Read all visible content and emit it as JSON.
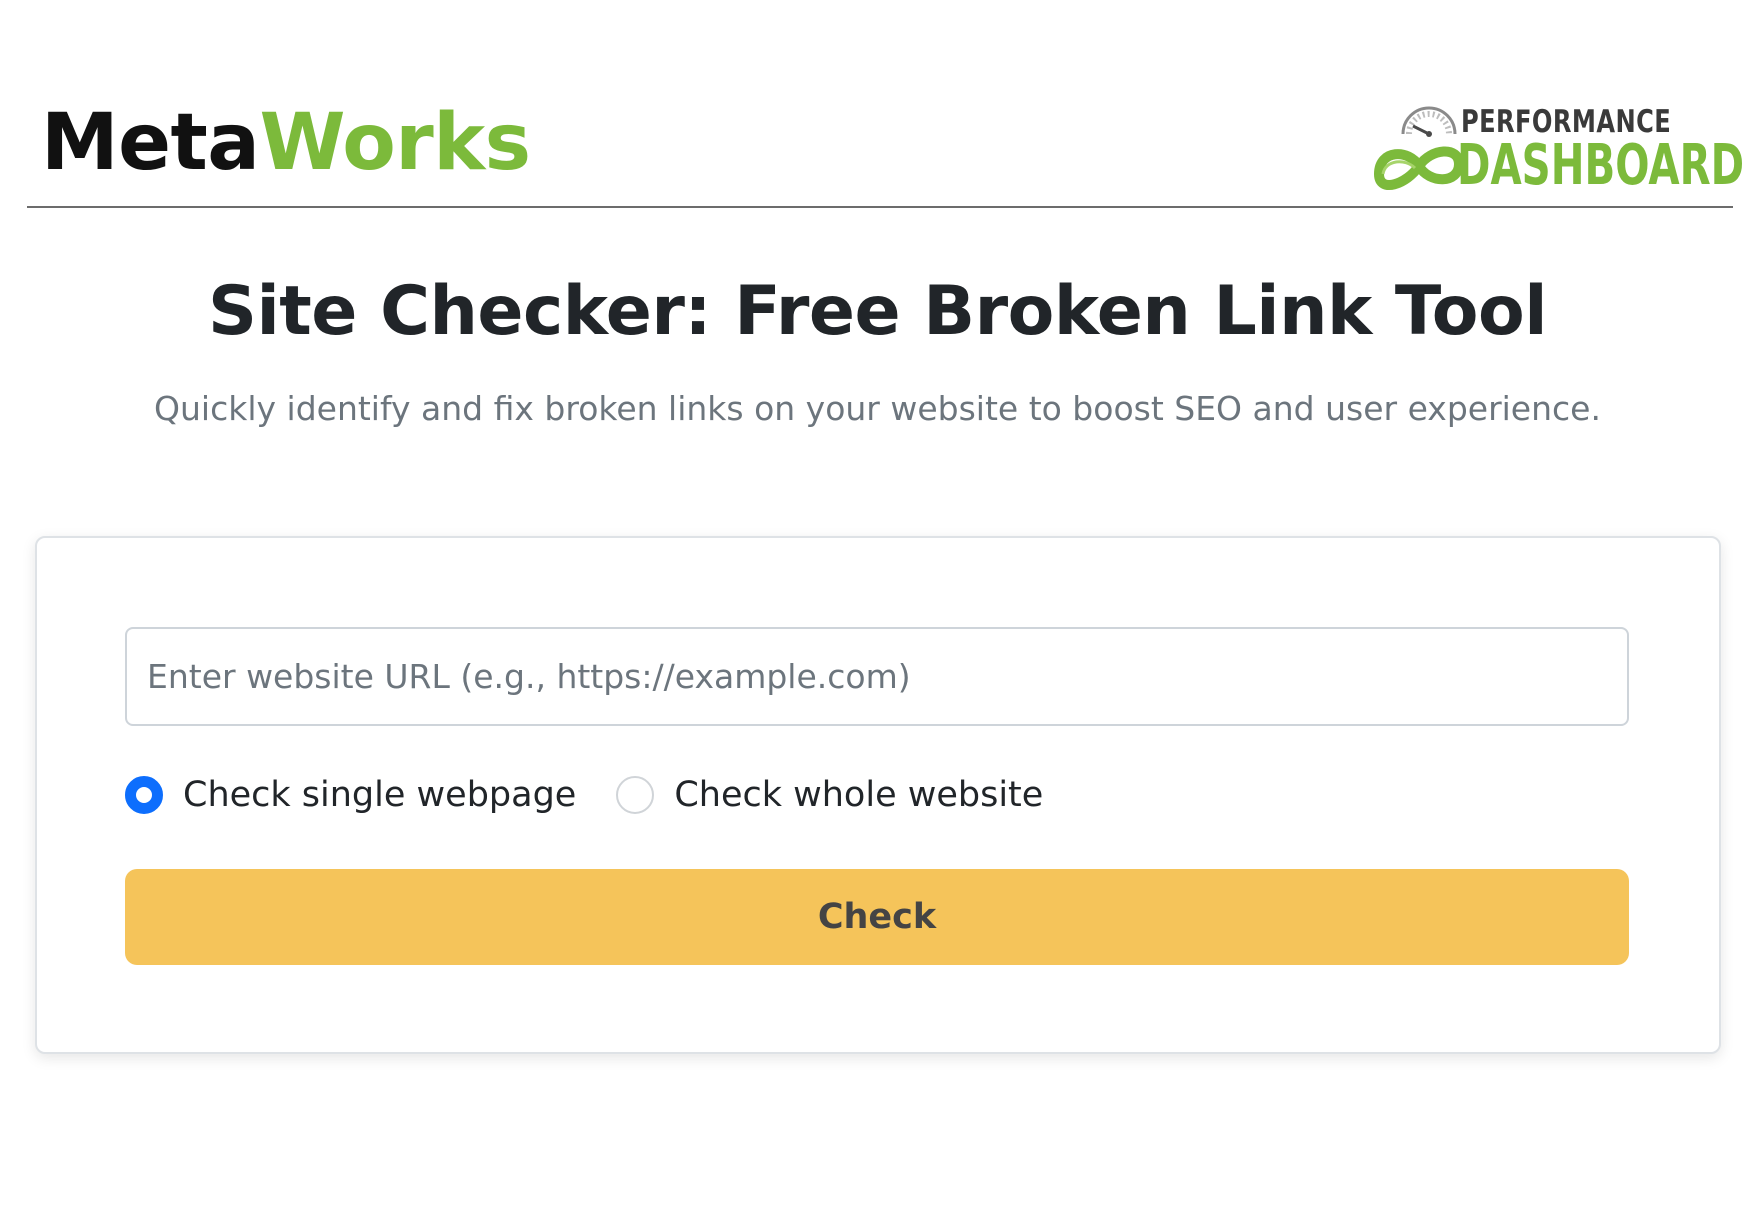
{
  "header": {
    "brand": {
      "part_a": "Meta",
      "part_b": "Works"
    },
    "partner_logo": {
      "line1": "PERFORMANCE",
      "line2": "DASHBOARD"
    }
  },
  "hero": {
    "title": "Site Checker: Free Broken Link Tool",
    "subtitle": "Quickly identify and fix broken links on your website to boost SEO and user experience."
  },
  "form": {
    "url_input": {
      "value": "",
      "placeholder": "Enter website URL (e.g., https://example.com)"
    },
    "options": [
      {
        "label": "Check single webpage",
        "selected": true
      },
      {
        "label": "Check whole website",
        "selected": false
      }
    ],
    "submit_label": "Check"
  },
  "colors": {
    "brand_green": "#7cba3b",
    "radio_selected": "#0d6efd",
    "button_bg": "#f5c45a"
  },
  "icons": {
    "partner_logo_mark": "speedometer-infinity-icon"
  }
}
